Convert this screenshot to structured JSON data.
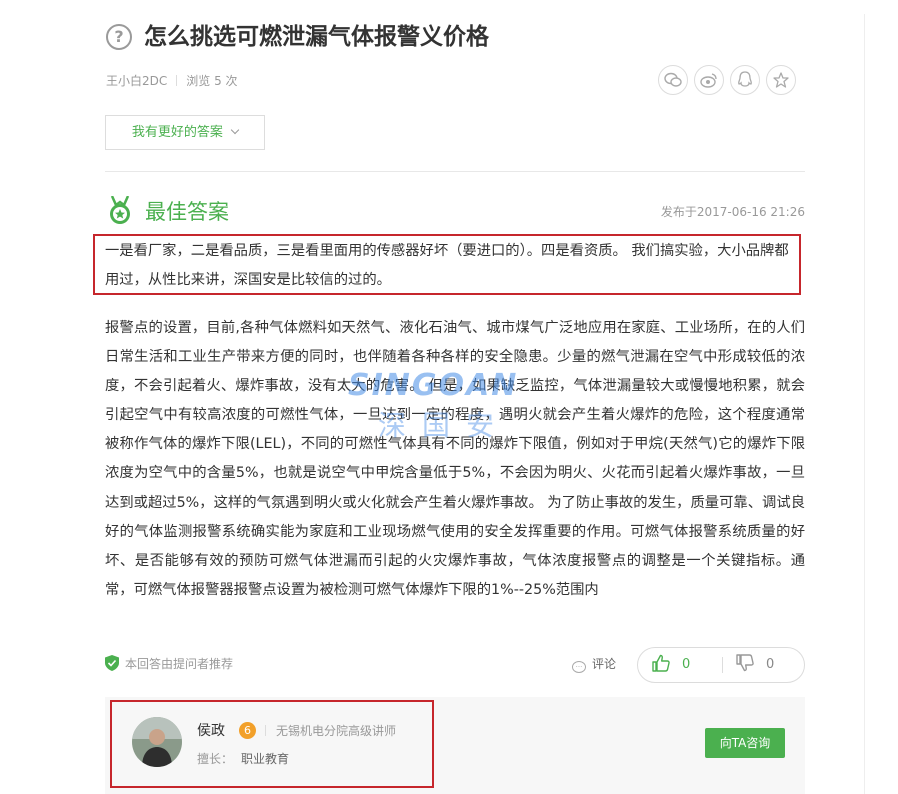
{
  "question": {
    "title": "怎么挑选可燃泄漏气体报警义价格",
    "author": "王小白2DC",
    "views": "浏览 5 次"
  },
  "share_icons": [
    "wechat-icon",
    "weibo-icon",
    "qq-icon",
    "star-icon"
  ],
  "better_answer_button": "我有更好的答案",
  "best_answer": {
    "heading": "最佳答案",
    "published": "发布于2017-06-16 21:26",
    "highlight_text": "一是看厂家，二是看品质，三是看里面用的传感器好坏（要进口的）。四是看资质。 我们搞实验，大小品牌都用过，从性比来讲，深国安是比较信的过的。",
    "body_text": "报警点的设置，目前,各种气体燃料如天然气、液化石油气、城市煤气广泛地应用在家庭、工业场所，在的人们日常生活和工业生产带来方便的同时，也伴随着各种各样的安全隐患。少量的燃气泄漏在空气中形成较低的浓度，不会引起着火、爆炸事故，没有太大的危害。              但是，如果缺乏监控，气体泄漏量较大或慢慢地积累，就会引起空气中有较高浓度的可燃性气体，一旦达到一定的程度，遇明火就会产生着火爆炸的危险，这个程度通常被称作气体的爆炸下限(LEL)，不同的可燃性气体具有不同的爆炸下限值，例如对于甲烷(天然气)它的爆炸下限浓度为空气中的含量5%，也就是说空气中甲烷含量低于5%，不会因为明火、火花而引起着火爆炸事故，一旦达到或超过5%，这样的气氛遇到明火或火化就会产生着火爆炸事故。              为了防止事故的发生，质量可靠、调试良好的气体监测报警系统确实能为家庭和工业现场燃气使用的安全发挥重要的作用。可燃气体报警系统质量的好坏、是否能够有效的预防可燃气体泄漏而引起的火灾爆炸事故，气体浓度报警点的调整是一个关键指标。通常，可燃气体报警器报警点设置为被检测可燃气体爆炸下限的1%--25%范围内",
    "recommended": "本回答由提问者推荐",
    "comment_label": "评论",
    "upvotes": "0",
    "downvotes": "0"
  },
  "watermark": {
    "en": "SINGOAN",
    "cn": "深国安"
  },
  "answerer": {
    "name": "侯政",
    "badge": "6",
    "title": "无锡机电分院高级讲师",
    "specialty_label": "擅长：",
    "specialty_value": "职业教育",
    "consult_button": "向TA咨询"
  },
  "colors": {
    "brand_green": "#4bb04f",
    "highlight_red": "#c6262c",
    "watermark_blue": "#468ce6"
  }
}
